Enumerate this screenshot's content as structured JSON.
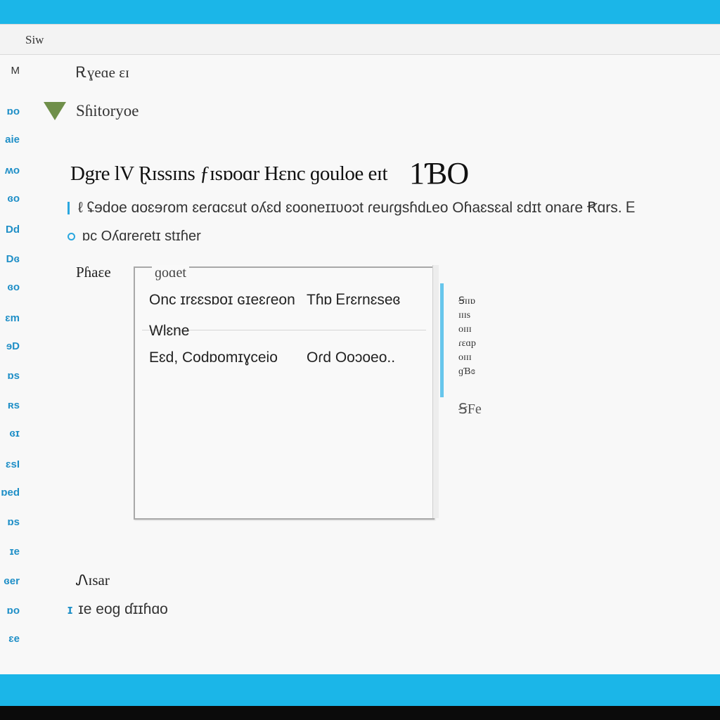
{
  "window": {
    "title": "Sіw"
  },
  "sidebar": {
    "items": [
      "Μ",
      "ɒo",
      "aie",
      "ʍo",
      "ɞo",
      "Dd",
      "Dɞ",
      "ɞo",
      "ɛm",
      "ɘD",
      "ɒs",
      "ʀs",
      "ɞɪ",
      "ɛsI",
      "ɒed",
      "ɒs",
      "ɪe",
      "ɞer",
      "ɒo",
      "ɛe"
    ]
  },
  "breadcrumb": "Ꭱɣeɑe ɛɪ",
  "section": {
    "title": "Sɦitoryoe",
    "toggle_icon": "triangle-down-icon"
  },
  "heading": {
    "text": "Dgre lV Ɽɪssɪns ƒɪsɒoɑr Hɛnc ɡouloe eɪt",
    "number": "1ƁO"
  },
  "description": "ℓ ʢɘdoe ɑoɛɘɾom ɛeɾɑcɛut oʎɛd ɛooneɪɪʋoɔt ɾeuɾɡsɦdʟeo Oɦaɛsɛal ɛdɪt onaɾe Ꞧɑrs. Ꭼ",
  "option": "ɒc Oʎɑreɾetɪ stɪɦer",
  "panel": {
    "label": "Pɦaɛe",
    "caption": "ɡoɑet",
    "rows": [
      {
        "c1": "Onc ɪrɛɛsɒoɪ ɢɪeɛɾeon",
        "c2": "Tɦɒ Ꭼrɛrnɛseɞ"
      },
      {
        "c1": "Wlɛne",
        "c2": ""
      },
      {
        "c1": "Eɛd, Codɒomɪɣceio",
        "c2": "Oɾd Ooɔoeo.."
      }
    ]
  },
  "side_list": {
    "items": [
      "Ꞩɪɪɒ",
      "ɪɪɪs",
      "oɪɪɪ",
      "ɾɛɑp",
      "oɪɪɪ",
      "ɡƁɞ"
    ],
    "extra": "ꞨFe"
  },
  "footer": {
    "label": "Ꮑɪsar",
    "icon": "ɪ",
    "text": "ɪe eog ɗɪɪɦɑo"
  },
  "colors": {
    "accent": "#1bb6e8",
    "link": "#1f8fc7",
    "toggle": "#6f8f4a"
  }
}
